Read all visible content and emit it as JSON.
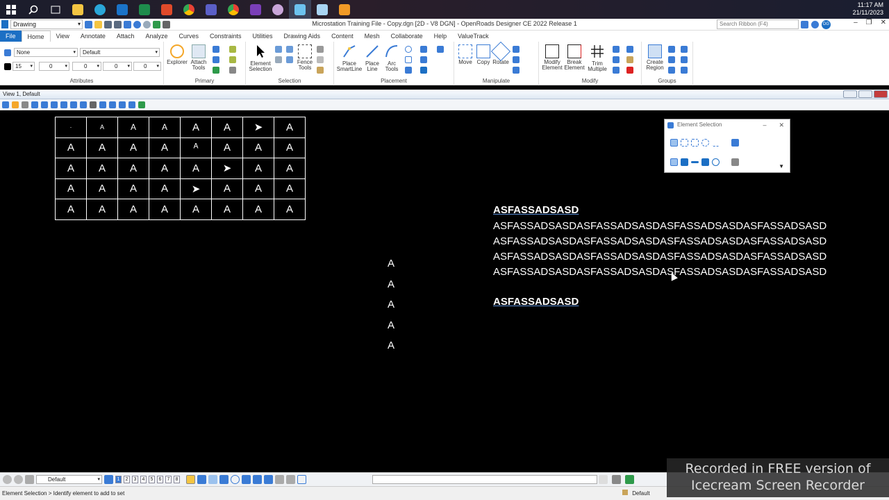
{
  "taskbar": {
    "time": "11:17 AM",
    "date": "21/11/2023",
    "apps": [
      "windows-start",
      "search",
      "task-view",
      "file-explorer",
      "edge",
      "outlook",
      "excel",
      "office",
      "chrome",
      "teams",
      "chrome-profile",
      "onenote",
      "app",
      "openroads",
      "app2",
      "app3"
    ]
  },
  "titlebar": {
    "workflow": "Drawing",
    "title": "Microstation Training File - Copy.dgn [2D - V8 DGN] - OpenRoads Designer CE 2022 Release 1",
    "search_placeholder": "Search Ribbon (F4)",
    "user_initials": "DG"
  },
  "tabs": [
    "File",
    "Home",
    "View",
    "Annotate",
    "Attach",
    "Analyze",
    "Curves",
    "Constraints",
    "Utilities",
    "Drawing Aids",
    "Content",
    "Mesh",
    "Collaborate",
    "Help",
    "ValueTrack"
  ],
  "ribbon": {
    "attributes": {
      "level": "None",
      "style": "Default",
      "color": "15",
      "weight": "0",
      "linestyle": "0",
      "transparency": "0",
      "priority": "0",
      "label": "Attributes"
    },
    "primary": {
      "explorer": "Explorer",
      "attach": "Attach",
      "attach2": "Tools",
      "label": "Primary"
    },
    "selection": {
      "element": "Element",
      "element2": "Selection",
      "fence": "Fence",
      "fence2": "Tools",
      "label": "Selection"
    },
    "placement": {
      "smartline": "Place",
      "smartline2": "SmartLine",
      "line": "Place",
      "line2": "Line",
      "arc": "Arc",
      "arc2": "Tools",
      "label": "Placement"
    },
    "manipulate": {
      "move": "Move",
      "copy": "Copy",
      "rotate": "Rotate",
      "label": "Manipulate"
    },
    "modify": {
      "modify": "Modify",
      "modify2": "Element",
      "break": "Break",
      "break2": "Element",
      "trim": "Trim",
      "trim2": "Multiple",
      "label": "Modify"
    },
    "groups": {
      "region": "Create",
      "region2": "Region",
      "label": "Groups"
    }
  },
  "view": {
    "title": "View 1, Default"
  },
  "drawing": {
    "table": [
      [
        "·",
        "A",
        "A",
        "A",
        "A",
        "A",
        "➤",
        "A"
      ],
      [
        "A",
        "A",
        "A",
        "A",
        "ᴬ",
        "A",
        "A",
        "A"
      ],
      [
        "A",
        "A",
        "A",
        "A",
        "A",
        "➤",
        "A",
        "A"
      ],
      [
        "A",
        "A",
        "A",
        "A",
        "➤",
        "A",
        "A",
        "A"
      ],
      [
        "A",
        "A",
        "A",
        "A",
        "A",
        "A",
        "A",
        "A"
      ]
    ],
    "column_letters": [
      "A",
      "A",
      "A",
      "A",
      "A"
    ],
    "heading1": "ASFASSADSASD",
    "lines": [
      "ASFASSADSASDASFASSADSASDASFASSADSASDASFASSADSASD",
      "ASFASSADSASDASFASSADSASDASFASSADSASDASFASSADSASD",
      "ASFASSADSASDASFASSADSASDASFASSADSASDASFASSADSASD",
      "ASFASSADSASDASFASSADSASDASFASSADSASDASFASSADSASD"
    ],
    "heading2": "ASFASSADSASD"
  },
  "dialog": {
    "title": "Element Selection"
  },
  "bottom": {
    "view_group": "Default",
    "view_numbers": [
      "1",
      "2",
      "3",
      "4",
      "5",
      "6",
      "7",
      "8"
    ],
    "status": "Element Selection > Identify element to add to set",
    "model": "Default"
  },
  "watermark": {
    "line1": "Recorded in FREE version of",
    "line2": "Icecream   Screen   Recorder"
  },
  "colors": {
    "file_tab": "#1c6fc4",
    "canvas": "#000000",
    "accent": "#3a7bd5"
  }
}
